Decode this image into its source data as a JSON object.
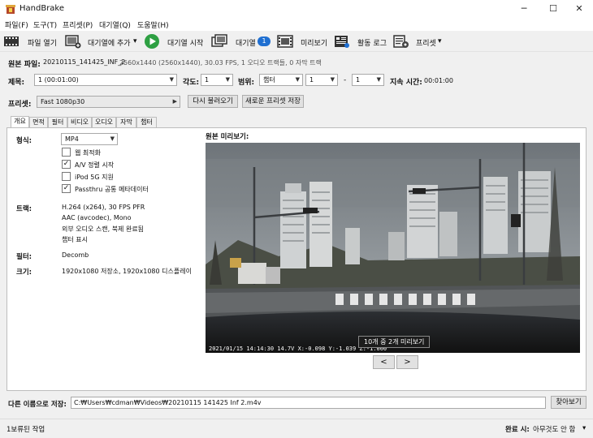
{
  "window": {
    "title": "HandBrake",
    "minimize": "─",
    "maximize": "☐",
    "close": "✕"
  },
  "menu": [
    "파일(F)",
    "도구(T)",
    "프리셋(P)",
    "대기열(Q)",
    "도움말(H)"
  ],
  "toolbar": {
    "open_source": "파일 열기",
    "add_to_queue": "대기열에 추가",
    "add_to_queue_dropdown": "▾",
    "start_queue": "대기열 시작",
    "queue": "대기열",
    "queue_count": "1",
    "preview": "미리보기",
    "activity_log": "활동 로그",
    "presets": "프리셋",
    "presets_dropdown": "▾"
  },
  "source": {
    "label": "원본 파일:",
    "name": "20210115_141425_INF_2",
    "details": "2560x1440 (2560x1440), 30.03 FPS, 1 오디오 트랙들, 0 자막 트랙"
  },
  "title_row": {
    "title_label": "제목:",
    "title_value": "1  (00:01:00)",
    "angle_label": "각도:",
    "angle_value": "1",
    "range_label": "범위:",
    "range_type": "챕터",
    "range_start": "1",
    "range_sep": "-",
    "range_end": "1",
    "duration_label": "지속 시간:",
    "duration_value": "00:01:00"
  },
  "preset_row": {
    "label": "프리셋:",
    "value": "Fast 1080p30",
    "reload_button": "다시 불러오기",
    "save_new_button": "새로운 프리셋 저장"
  },
  "tabs": [
    "개요",
    "면적",
    "필터",
    "비디오",
    "오디오",
    "자막",
    "챕터"
  ],
  "summary": {
    "format_label": "형식:",
    "format_value": "MP4",
    "options": [
      {
        "label": "웹 최적화",
        "checked": false
      },
      {
        "label": "A/V 정렬 시작",
        "checked": true
      },
      {
        "label": "iPod 5G 지원",
        "checked": false
      },
      {
        "label": "Passthru 공통 메타데이터",
        "checked": true
      }
    ],
    "tracks_label": "트랙:",
    "tracks": [
      "H.264 (x264), 30 FPS PFR",
      "AAC (avcodec), Mono",
      "외부 오디오 스캔, 북제 완료됨",
      "챕터 표시"
    ],
    "filters_label": "필터:",
    "filters_value": "Decomb",
    "size_label": "크기:",
    "size_value": "1920x1080 저장소, 1920x1080 디스플레이"
  },
  "preview": {
    "label": "원본 미리보기:",
    "overlay": "10개 중 2개 미리보기",
    "stamp": "2021/01/15 14:14:30  14.7V  X:-0.098  Y:-1.039  Z:-1.000",
    "prev_button": "<",
    "next_button": ">"
  },
  "save_as": {
    "label": "다른 이름으로 저장:",
    "path": "C:₩Users₩cdman₩Videos₩20210115 141425 Inf 2.m4v",
    "browse_button": "찾아보기"
  },
  "status": {
    "left": "1보류된 작업",
    "when_done_label": "완료 시:",
    "when_done_value": "아무것도 안 함",
    "when_done_dropdown": "▾"
  },
  "colors": {
    "accent": "#1f6fd1",
    "play_green": "#2ea043"
  }
}
